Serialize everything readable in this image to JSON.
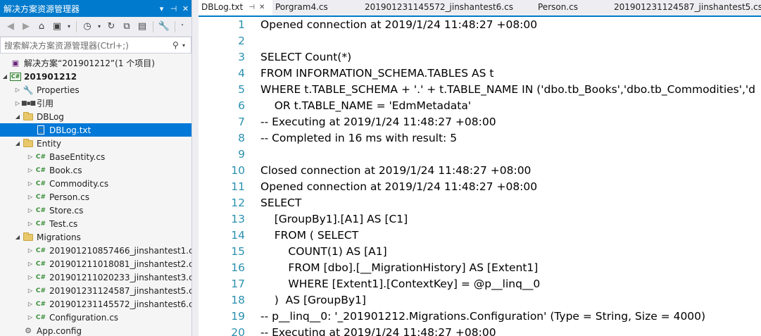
{
  "solution_explorer": {
    "title": "解决方案资源管理器",
    "title_buttons": [
      "▾",
      "⊣",
      "✕"
    ],
    "search_placeholder": "搜索解决方案资源管理器(Ctrl+;)",
    "tree": [
      {
        "label": "解决方案“201901212”(1 个项目)",
        "indent": 0,
        "arrow": "",
        "icon": "solution-icon"
      },
      {
        "label": "201901212",
        "indent": 0,
        "arrow": "◢",
        "icon": "csharp-project-icon",
        "bold": true
      },
      {
        "label": "Properties",
        "indent": 1,
        "arrow": "▷",
        "icon": "wrench-icon"
      },
      {
        "label": "引用",
        "indent": 1,
        "arrow": "▷",
        "icon": "references-icon"
      },
      {
        "label": "DBLog",
        "indent": 1,
        "arrow": "◢",
        "icon": "folder-open-icon"
      },
      {
        "label": "DBLog.txt",
        "indent": 2,
        "arrow": "",
        "icon": "text-file-icon",
        "selected": true
      },
      {
        "label": "Entity",
        "indent": 1,
        "arrow": "◢",
        "icon": "folder-open-icon"
      },
      {
        "label": "BaseEntity.cs",
        "indent": 2,
        "arrow": "▷",
        "icon": "csharp-file-icon"
      },
      {
        "label": "Book.cs",
        "indent": 2,
        "arrow": "▷",
        "icon": "csharp-file-icon"
      },
      {
        "label": "Commodity.cs",
        "indent": 2,
        "arrow": "▷",
        "icon": "csharp-file-icon"
      },
      {
        "label": "Person.cs",
        "indent": 2,
        "arrow": "▷",
        "icon": "csharp-file-icon"
      },
      {
        "label": "Store.cs",
        "indent": 2,
        "arrow": "▷",
        "icon": "csharp-file-icon"
      },
      {
        "label": "Test.cs",
        "indent": 2,
        "arrow": "▷",
        "icon": "csharp-file-icon"
      },
      {
        "label": "Migrations",
        "indent": 1,
        "arrow": "◢",
        "icon": "folder-open-icon"
      },
      {
        "label": "201901210857466_jinshantest1.c",
        "indent": 2,
        "arrow": "▷",
        "icon": "csharp-file-icon"
      },
      {
        "label": "201901211018081_jinshantest2.c",
        "indent": 2,
        "arrow": "▷",
        "icon": "csharp-file-icon"
      },
      {
        "label": "201901211020233_jinshantest3.c",
        "indent": 2,
        "arrow": "▷",
        "icon": "csharp-file-icon"
      },
      {
        "label": "201901231124587_jinshantest5.c",
        "indent": 2,
        "arrow": "▷",
        "icon": "csharp-file-icon"
      },
      {
        "label": "201901231145572_jinshantest6.c",
        "indent": 2,
        "arrow": "▷",
        "icon": "csharp-file-icon"
      },
      {
        "label": "Configuration.cs",
        "indent": 2,
        "arrow": "▷",
        "icon": "csharp-file-icon"
      },
      {
        "label": "App.config",
        "indent": 1,
        "arrow": "",
        "icon": "config-file-icon"
      }
    ]
  },
  "tabs": [
    {
      "label": "DBLog.txt",
      "active": true,
      "pin": "⊣",
      "close": "✕"
    },
    {
      "label": "Porgram4.cs",
      "active": false
    },
    {
      "label": "201901231145572_jinshantest6.cs",
      "active": false
    },
    {
      "label": "Person.cs",
      "active": false
    },
    {
      "label": "201901231124587_jinshantest5.cs",
      "active": false
    }
  ],
  "editor": {
    "lines": [
      {
        "n": "1",
        "text": "Opened connection at 2019/1/24 11:48:27 +08:00"
      },
      {
        "n": "2",
        "text": ""
      },
      {
        "n": "3",
        "text": "SELECT Count(*)"
      },
      {
        "n": "4",
        "text": "FROM INFORMATION_SCHEMA.TABLES AS t"
      },
      {
        "n": "5",
        "text": "WHERE t.TABLE_SCHEMA + '.' + t.TABLE_NAME IN ('dbo.tb_Books','dbo.tb_Commodities','d"
      },
      {
        "n": "6",
        "text": "    OR t.TABLE_NAME = 'EdmMetadata'"
      },
      {
        "n": "7",
        "text": "-- Executing at 2019/1/24 11:48:27 +08:00"
      },
      {
        "n": "8",
        "text": "-- Completed in 16 ms with result: 5"
      },
      {
        "n": "9",
        "text": ""
      },
      {
        "n": "10",
        "text": "Closed connection at 2019/1/24 11:48:27 +08:00"
      },
      {
        "n": "11",
        "text": "Opened connection at 2019/1/24 11:48:27 +08:00"
      },
      {
        "n": "12",
        "text": "SELECT"
      },
      {
        "n": "13",
        "text": "    [GroupBy1].[A1] AS [C1]"
      },
      {
        "n": "14",
        "text": "    FROM ( SELECT"
      },
      {
        "n": "15",
        "text": "        COUNT(1) AS [A1]"
      },
      {
        "n": "16",
        "text": "        FROM [dbo].[__MigrationHistory] AS [Extent1]"
      },
      {
        "n": "17",
        "text": "        WHERE [Extent1].[ContextKey] = @p__linq__0"
      },
      {
        "n": "18",
        "text": "    )  AS [GroupBy1]"
      },
      {
        "n": "19",
        "text": "-- p__linq__0: '_201901212.Migrations.Configuration' (Type = String, Size = 4000)"
      },
      {
        "n": "20",
        "text": "-- Executing at 2019/1/24 11:48:27 +08:00"
      }
    ]
  }
}
